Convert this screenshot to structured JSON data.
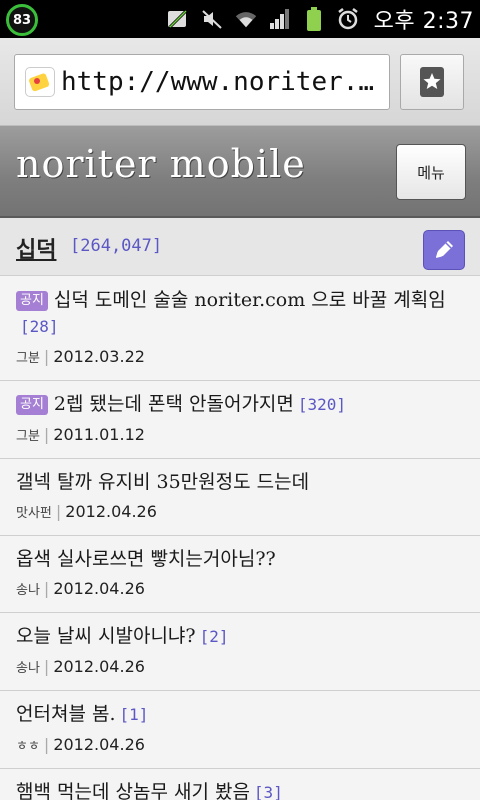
{
  "status": {
    "badge": "83",
    "time": "오후 2:37"
  },
  "browser": {
    "url": "http://www.noriter.…"
  },
  "site": {
    "title": "noriter mobile",
    "menu_label": "메뉴"
  },
  "board": {
    "name": "십덕",
    "count": "[264,047]"
  },
  "posts": [
    {
      "notice": "공지",
      "title": "십덕 도메인 술술 noriter.com 으로 바꿀 계획임",
      "comments": "[28]",
      "author": "그분",
      "date": "2012.03.22"
    },
    {
      "notice": "공지",
      "title": "2렙 됐는데 폰택 안돌어가지면",
      "comments": "[320]",
      "author": "그분",
      "date": "2011.01.12"
    },
    {
      "notice": "",
      "title": "갤넥 탈까 유지비 35만원정도 드는데",
      "comments": "",
      "author": "맛사펀",
      "date": "2012.04.26"
    },
    {
      "notice": "",
      "title": "옵색 실사로쓰면 빻치는거아님??",
      "comments": "",
      "author": "송나",
      "date": "2012.04.26"
    },
    {
      "notice": "",
      "title": "오늘 날씨 시발아니냐?",
      "comments": "[2]",
      "author": "송나",
      "date": "2012.04.26"
    },
    {
      "notice": "",
      "title": "언터쳐블 봄.",
      "comments": "[1]",
      "author": "ㅎㅎ",
      "date": "2012.04.26"
    },
    {
      "notice": "",
      "title": "햄백 먹는데 상놈무 새기 봤음",
      "comments": "[3]",
      "author": "",
      "date": ""
    }
  ]
}
